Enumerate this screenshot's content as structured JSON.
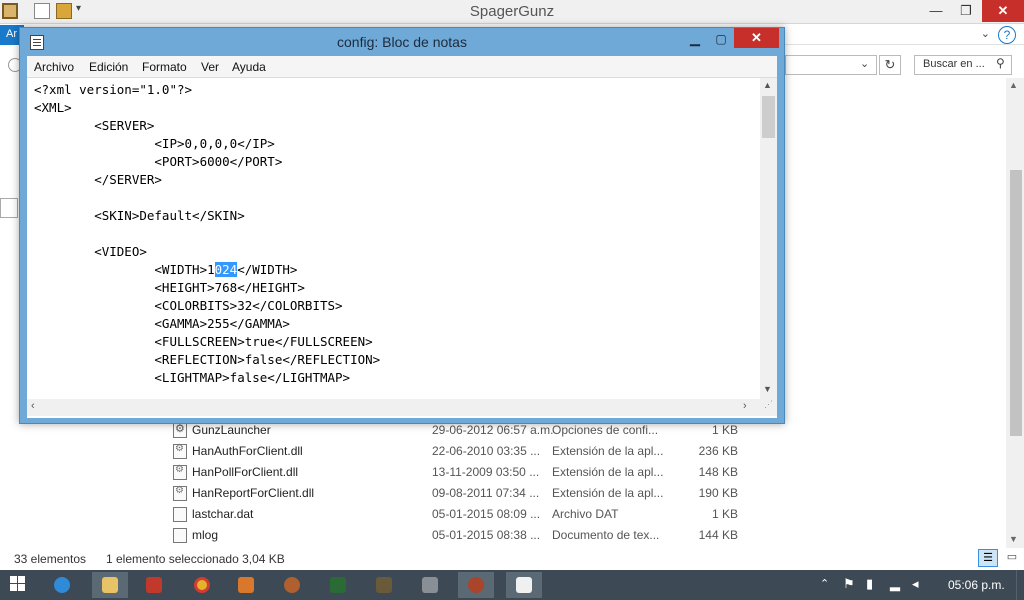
{
  "explorer": {
    "title": "SpagerGunz",
    "ribbon_tab_stub": "Ar",
    "search_placeholder": "Buscar en ...",
    "files": [
      {
        "name": "GunzLauncher",
        "date": "29-06-2012 06:57 a.m.",
        "type": "Opciones de confi...",
        "size": "1 KB",
        "icon": "config-file-icon"
      },
      {
        "name": "HanAuthForClient.dll",
        "date": "22-06-2010 03:35 ...",
        "type": "Extensión de la apl...",
        "size": "236 KB",
        "icon": "dll-file-icon"
      },
      {
        "name": "HanPollForClient.dll",
        "date": "13-11-2009 03:50 ...",
        "type": "Extensión de la apl...",
        "size": "148 KB",
        "icon": "dll-file-icon"
      },
      {
        "name": "HanReportForClient.dll",
        "date": "09-08-2011 07:34 ...",
        "type": "Extensión de la apl...",
        "size": "190 KB",
        "icon": "dll-file-icon"
      },
      {
        "name": "lastchar.dat",
        "date": "05-01-2015 08:09 ...",
        "type": "Archivo DAT",
        "size": "1 KB",
        "icon": "file-icon"
      },
      {
        "name": "mlog",
        "date": "05-01-2015 08:38 ...",
        "type": "Documento de tex...",
        "size": "144 KB",
        "icon": "text-file-icon"
      }
    ],
    "status": {
      "count": "33 elementos",
      "selection": "1 elemento seleccionado  3,04 KB"
    }
  },
  "notepad": {
    "title": "config: Bloc de notas",
    "menu": [
      "Archivo",
      "Edición",
      "Formato",
      "Ver",
      "Ayuda"
    ],
    "text_before_sel": "<?xml version=\"1.0\"?>\n<XML>\n        <SERVER>\n                <IP>0,0,0,0</IP>\n                <PORT>6000</PORT>\n        </SERVER>\n\n        <SKIN>Default</SKIN>\n\n        <VIDEO>\n                <WIDTH>1",
    "text_selected": "024",
    "text_after_sel": "</WIDTH>\n                <HEIGHT>768</HEIGHT>\n                <COLORBITS>32</COLORBITS>\n                <GAMMA>255</GAMMA>\n                <FULLSCREEN>true</FULLSCREEN>\n                <REFLECTION>false</REFLECTION>\n                <LIGHTMAP>false</LIGHTMAP>"
  },
  "taskbar": {
    "clock": "05:06 p.m.",
    "apps": [
      "explorer",
      "file-explorer",
      "app-red",
      "chrome",
      "app-orange",
      "app-gear",
      "app-green",
      "app-game",
      "app-mask",
      "app-ball",
      "notepad"
    ]
  },
  "colors": {
    "notepad_frame": "#6ea9d8",
    "close_red": "#c7302a",
    "selection": "#3399ff",
    "taskbar": "#3d4a55"
  }
}
